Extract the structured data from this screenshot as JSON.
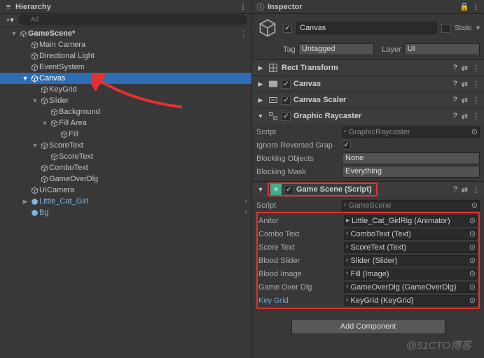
{
  "hierarchy": {
    "title": "Hierarchy",
    "search_placeholder": "All",
    "scene": "GameScene*",
    "items": {
      "main_camera": "Main Camera",
      "directional_light": "Directional Light",
      "event_system": "EventSystem",
      "canvas": "Canvas",
      "key_grid": "KeyGrid",
      "slider": "Slider",
      "background": "Background",
      "fill_area": "Fill Area",
      "fill": "Fill",
      "score_text_parent": "ScoreText",
      "score_text": "ScoreText",
      "combo_text": "ComboText",
      "game_over_dlg": "GameOverDlg",
      "ui_camera": "UICamera",
      "little_cat_girl": "Little_Cat_Girl",
      "bg": "Bg"
    }
  },
  "inspector": {
    "title": "Inspector",
    "object_name": "Canvas",
    "static_label": "Static",
    "tag_label": "Tag",
    "tag_value": "Untagged",
    "layer_label": "Layer",
    "layer_value": "UI",
    "components": {
      "rect_transform": "Rect Transform",
      "canvas": "Canvas",
      "canvas_scaler": "Canvas Scaler",
      "graphic_raycaster": {
        "title": "Graphic Raycaster",
        "script_label": "Script",
        "script_value": "GraphicRaycaster",
        "ignore_label": "Ignore Reversed Grap",
        "blocking_obj_label": "Blocking Objects",
        "blocking_obj_value": "None",
        "blocking_mask_label": "Blocking Mask",
        "blocking_mask_value": "Everything"
      },
      "game_scene": {
        "title": "Game Scene (Script)",
        "script_label": "Script",
        "script_value": "GameScene",
        "anitor_label": "Anitor",
        "anitor_value": "Little_Cat_GirlRig (Animator)",
        "combo_label": "Combo Text",
        "combo_value": "ComboText (Text)",
        "score_label": "Score Text",
        "score_value": "ScoreText (Text)",
        "blood_slider_label": "Blood Slider",
        "blood_slider_value": "Slider (Slider)",
        "blood_image_label": "Blood Image",
        "blood_image_value": "Fill (Image)",
        "gameover_label": "Game Over Dlg",
        "gameover_value": "GameOverDlg (GameOverDlg)",
        "keygrid_label": "Key Grid",
        "keygrid_value": "KeyGrid (KeyGrid)"
      }
    },
    "add_component": "Add Component"
  },
  "watermark": "@51CTO博客"
}
